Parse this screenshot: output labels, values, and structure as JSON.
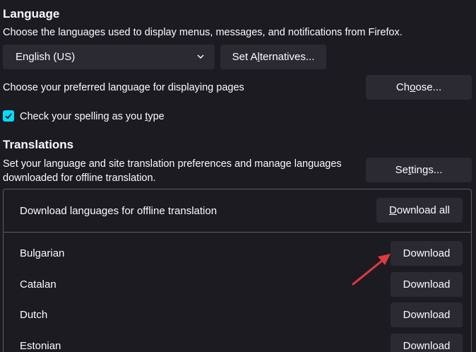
{
  "language": {
    "heading": "Language",
    "description": "Choose the languages used to display menus, messages, and notifications from Firefox.",
    "selected_language": "English (US)",
    "set_alternatives_pre": "Set A",
    "set_alternatives_key": "l",
    "set_alternatives_post": "ternatives...",
    "page_language_text": "Choose your preferred language for displaying pages",
    "choose_pre": "Ch",
    "choose_key": "o",
    "choose_post": "ose...",
    "spell_check_pre": "Check your spelling as you ",
    "spell_check_key": "t",
    "spell_check_post": "ype",
    "spell_check_checked": true
  },
  "translations": {
    "heading": "Translations",
    "description_line1": "Set your language and site translation preferences and manage languages",
    "description_line2": "downloaded for offline translation.",
    "settings_pre": "Se",
    "settings_key": "t",
    "settings_post": "tings...",
    "panel": {
      "title": "Download languages for offline translation",
      "download_all_key": "D",
      "download_all_post": "ownload all",
      "languages": [
        {
          "name": "Bulgarian",
          "button": "Download"
        },
        {
          "name": "Catalan",
          "button": "Download"
        },
        {
          "name": "Dutch",
          "button": "Download"
        },
        {
          "name": "Estonian",
          "button": "Download"
        }
      ]
    }
  },
  "colors": {
    "background": "#1c1b22",
    "button": "#2b2a33",
    "accent": "#00ddff",
    "annotation_arrow": "#e0393e"
  }
}
